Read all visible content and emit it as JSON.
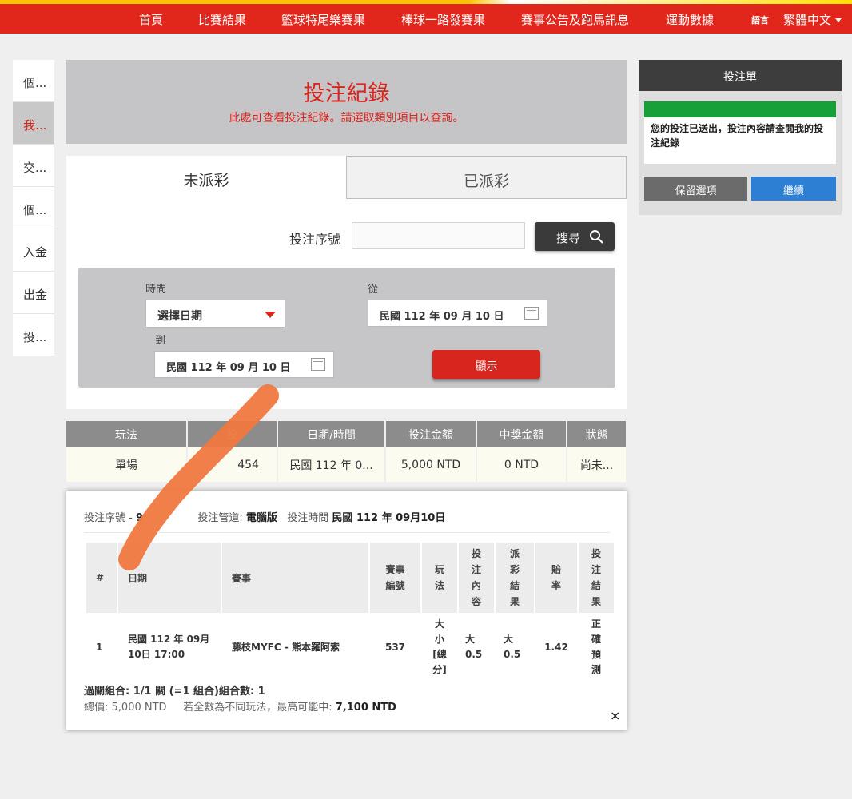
{
  "nav": {
    "items": [
      "首頁",
      "比賽結果",
      "籃球特尾樂賽果",
      "棒球一路發賽果",
      "賽事公告及跑馬訊息",
      "運動數據"
    ],
    "lang_icon": "語言",
    "lang": "繁體中文"
  },
  "sidebar": {
    "items": [
      "個...",
      "我...",
      "交...",
      "個...",
      "入金",
      "出金",
      "投..."
    ],
    "active_index": 1
  },
  "header": {
    "title": "投注紀錄",
    "subtitle": "此處可查看投注紀錄。請選取類別項目以查詢。"
  },
  "tabs": [
    "未派彩",
    "已派彩"
  ],
  "search": {
    "label": "投注序號",
    "value": "",
    "button": "搜尋",
    "icon": "search-icon"
  },
  "filter": {
    "time_label": "時間",
    "select_value": "選擇日期",
    "from_label": "從",
    "from_date": "民國 112 年 09 月 10 日",
    "to_label": "到",
    "to_date": "民國 112 年 09 月 10 日",
    "show_button": "顯示"
  },
  "summary": {
    "headers": [
      "玩法",
      "投",
      "日期/時間",
      "投注金額",
      "中獎金額",
      "狀態"
    ],
    "row": [
      "單場",
      "454",
      "民國 112 年 0...",
      "5,000 NTD",
      "0 NTD",
      "尚未..."
    ]
  },
  "detail": {
    "serial_label": "投注序號",
    "serial_value": "9",
    "channel_label": "投注管道",
    "channel_value": "電腦版",
    "time_label": "投注時間",
    "time_value": "民國 112 年 09月10日",
    "headers": {
      "num": "#",
      "date": "日期",
      "event": "賽事",
      "event_no": "賽事\n編號",
      "play": "玩\n法",
      "content": "投\n注\n內\n容",
      "result": "派\n彩\n結\n果",
      "odds": "賠\n率",
      "bet_result": "投\n注\n結\n果"
    },
    "row": {
      "num": "1",
      "date": "民國 112 年 09月 10日 17:00",
      "event": "藤枝MYFC - 熊本羅阿索",
      "event_no": "537",
      "play": "大\n小\n[總\n分]",
      "content": "大\n0.5",
      "result": "大\n0.5",
      "odds": "1.42",
      "bet_result": "正\n確\n預\n測"
    },
    "combo": "過關組合: 1/1 關 (=1 組合)組合數: 1",
    "total_label": "總價:",
    "total_value": "5,000 NTD",
    "max_label": "若全數為不同玩法，最高可能中:",
    "max_value": "7,100 NTD",
    "close": "×"
  },
  "betslip": {
    "title": "投注單",
    "message": "您的投注已送出，投注內容請查閱我的投注紀錄",
    "keep_button": "保留選項",
    "continue_button": "繼續",
    "colors": {
      "success": "#18a038",
      "continue": "#2d7fd3"
    }
  },
  "colors": {
    "brand_red": "#e1261c",
    "overlay_scribble": "#f07840"
  }
}
